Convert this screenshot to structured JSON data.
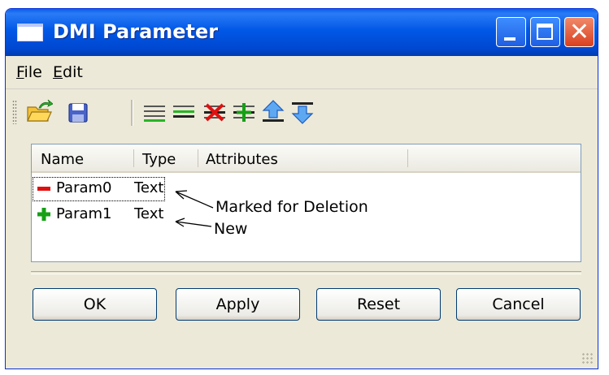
{
  "window": {
    "title": "DMI Parameter",
    "controls": [
      "minimize",
      "maximize",
      "close"
    ]
  },
  "menu": {
    "file_rest": "ile",
    "file_underline": "F",
    "edit_rest": "dit",
    "edit_underline": "E"
  },
  "toolbar": {
    "icons": [
      "open-folder-icon",
      "save-icon",
      "add-line-icon",
      "line-icon",
      "delete-line-icon",
      "insert-line-icon",
      "move-up-icon",
      "move-down-icon"
    ]
  },
  "table": {
    "columns": [
      "Name",
      "Type",
      "Attributes"
    ],
    "rows": [
      {
        "name": "Param0",
        "type": "Text",
        "status": "deleted"
      },
      {
        "name": "Param1",
        "type": "Text",
        "status": "new"
      }
    ]
  },
  "annotations": {
    "deleted": "Marked for Deletion",
    "new": "New"
  },
  "buttons": {
    "ok": "OK",
    "apply": "Apply",
    "reset": "Reset",
    "cancel": "Cancel"
  },
  "colors": {
    "titlebar": "#0058e6",
    "delete": "#e01010",
    "new": "#16a016",
    "toolbar_green": "#27b427"
  }
}
